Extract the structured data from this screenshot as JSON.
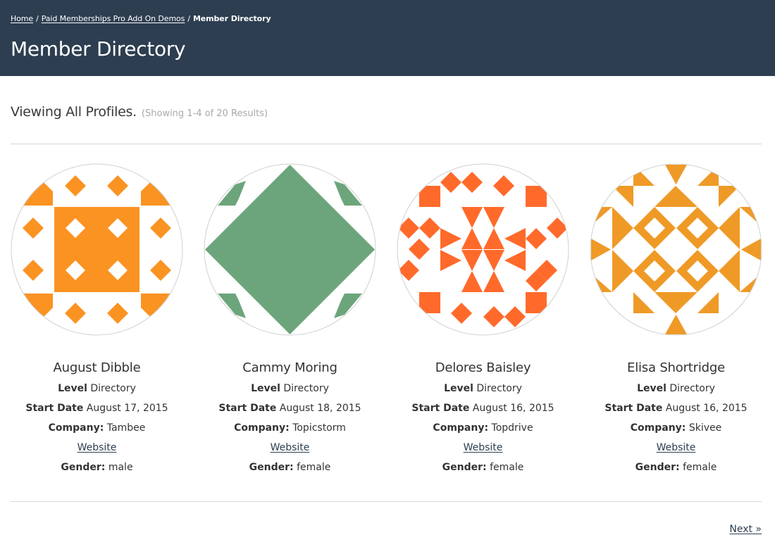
{
  "breadcrumb": {
    "home": "Home",
    "parent": "Paid Memberships Pro Add On Demos",
    "current": "Member Directory",
    "separator": "/"
  },
  "page_title": "Member Directory",
  "summary": {
    "lead": "Viewing All Profiles.",
    "count": "(Showing 1-4 of 20 Results)"
  },
  "labels": {
    "level": "Level",
    "start_date": "Start Date",
    "company": "Company:",
    "gender": "Gender:"
  },
  "members": [
    {
      "name": "August Dibble",
      "level": "Directory",
      "start_date": "August 17, 2015",
      "company": "Tambee",
      "website": "Website",
      "gender": "male",
      "avatar_icon": "identicon-orange-squares",
      "avatar_color": "#fb9322"
    },
    {
      "name": "Cammy Moring",
      "level": "Directory",
      "start_date": "August 18, 2015",
      "company": "Topicstorm",
      "website": "Website",
      "gender": "female",
      "avatar_icon": "identicon-green-diamond",
      "avatar_color": "#6ca57b"
    },
    {
      "name": "Delores Baisley",
      "level": "Directory",
      "start_date": "August 16, 2015",
      "company": "Topdrive",
      "website": "Website",
      "gender": "female",
      "avatar_icon": "identicon-red-triangles",
      "avatar_color": "#ff6a2b"
    },
    {
      "name": "Elisa Shortridge",
      "level": "Directory",
      "start_date": "August 16, 2015",
      "company": "Skivee",
      "website": "Website",
      "gender": "female",
      "avatar_icon": "identicon-amber-diamonds",
      "avatar_color": "#ef9a27"
    }
  ],
  "pagination": {
    "next": "Next »"
  },
  "colors": {
    "header_bg": "#2d3e50",
    "rule": "#d6d6d6",
    "link": "#2d3e50",
    "muted": "#a8a8a8"
  }
}
